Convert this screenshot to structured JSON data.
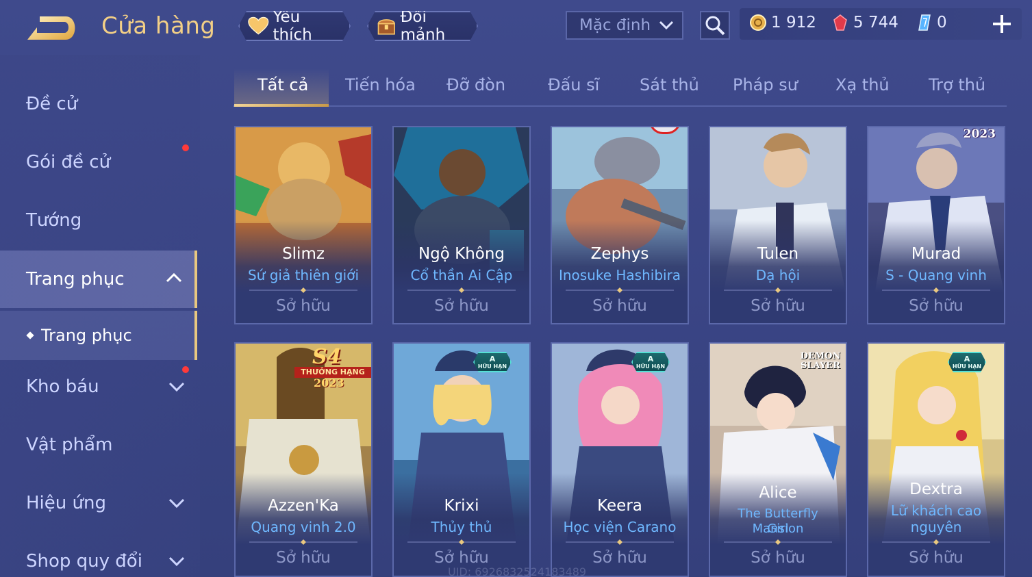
{
  "header": {
    "title": "Cửa hàng",
    "favorites_label": "Yêu thích",
    "exchange_label": "Đổi mảnh",
    "sort_value": "Mặc định"
  },
  "currency": {
    "gold": "1 912",
    "ruby": "5 744",
    "voucher": "0"
  },
  "sidebar": {
    "items": [
      {
        "label": "Đề cử",
        "has_dot": false
      },
      {
        "label": "Gói đề cử",
        "has_dot": true
      },
      {
        "label": "Tướng",
        "has_dot": false
      },
      {
        "label": "Trang phục",
        "has_dot": false,
        "active": true
      },
      {
        "label": "Kho báu",
        "has_dot": true
      },
      {
        "label": "Vật phẩm",
        "has_dot": false
      },
      {
        "label": "Hiệu ứng",
        "has_dot": false
      },
      {
        "label": "Shop quy đổi",
        "has_dot": false
      }
    ],
    "subitem": "Trang phục"
  },
  "tabs": [
    "Tất cả",
    "Tiến hóa",
    "Đỡ đòn",
    "Đấu sĩ",
    "Sát thủ",
    "Pháp sư",
    "Xạ thủ",
    "Trợ thủ"
  ],
  "cards": [
    {
      "hero": "Slimz",
      "skin": "Sứ giả thiên giới",
      "status": "Sở hữu"
    },
    {
      "hero": "Ngộ Không",
      "skin": "Cổ thần Ai Cập",
      "status": "Sở hữu"
    },
    {
      "hero": "Zephys",
      "skin": "Inosuke Hashibira",
      "status": "Sở hữu"
    },
    {
      "hero": "Tulen",
      "skin": "Dạ hội",
      "status": "Sở hữu"
    },
    {
      "hero": "Murad",
      "skin": "S - Quang vinh",
      "status": "Sở hữu",
      "badge_text": "2023"
    },
    {
      "hero": "Azzen'Ka",
      "skin": "Quang vinh 2.0",
      "status": "Sở hữu",
      "badge_big": "S4",
      "badge_ribbon": "THƯỞNG HẠNG",
      "badge_year": "2023"
    },
    {
      "hero": "Krixi",
      "skin": "Thủy thủ",
      "status": "Sở hữu",
      "badge_grade": "A",
      "badge_tag": "HỮU HẠN"
    },
    {
      "hero": "Keera",
      "skin": "Học viện Carano",
      "status": "Sở hữu",
      "badge_grade": "A",
      "badge_tag": "HỮU HẠN"
    },
    {
      "hero": "Alice",
      "skin_line1": "The Butterfly Mansion",
      "skin_line2": "Girl",
      "status": "Sở hữu",
      "badge_text": "DEMON SLAYER"
    },
    {
      "hero": "Dextra",
      "skin_line1": "Lữ khách cao",
      "skin_line2": "nguyên",
      "status": "Sở hữu",
      "badge_grade": "A",
      "badge_tag": "HỮU HẠN"
    }
  ],
  "uid": "UID: 6926832524183489",
  "colors": {
    "accent_gold": "#f2cf86",
    "skin_blue": "#6fb8ff",
    "background": "#3a4585",
    "notification": "#ff3a3a"
  }
}
